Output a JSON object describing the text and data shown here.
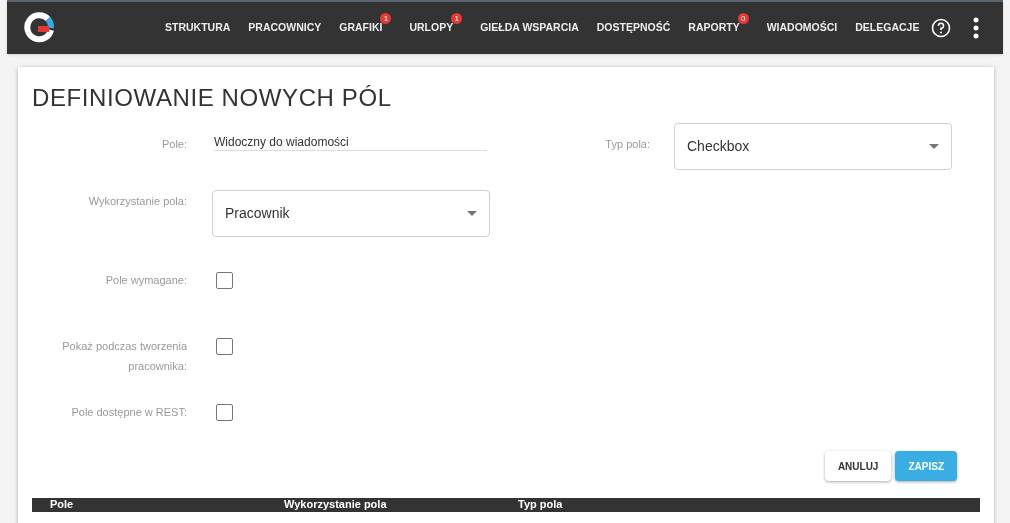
{
  "nav": {
    "items": [
      {
        "label": "STRUKTURA"
      },
      {
        "label": "PRACOWNICY"
      },
      {
        "label": "GRAFIKI",
        "badge": "1"
      },
      {
        "label": "URLOPY",
        "badge": "1"
      },
      {
        "label": "GIEŁDA WSPARCIA"
      },
      {
        "label": "DOSTĘPNOŚĆ"
      },
      {
        "label": "RAPORTY",
        "badge": "0"
      },
      {
        "label": "WIADOMOŚCI"
      },
      {
        "label": "DELEGACJE"
      }
    ]
  },
  "page": {
    "title": "DEFINIOWANIE NOWYCH PÓL"
  },
  "form": {
    "name_field": {
      "label": "Pole:",
      "value": "Widoczny do wiadomości"
    },
    "type_select": {
      "label": "Typ pola:",
      "value": "Checkbox"
    },
    "usage_select": {
      "label": "Wykorzystanie pola:",
      "value": "Pracownik"
    },
    "checkboxes": [
      {
        "label": "Pole wymagane:",
        "checked": false
      },
      {
        "label": "Pokaż podczas tworzenia pracownika:",
        "checked": false
      },
      {
        "label": "Pole dostępne w REST:",
        "checked": false
      }
    ]
  },
  "buttons": [
    {
      "label": "ANULUJ",
      "kind": "secondary"
    },
    {
      "label": "ZAPISZ",
      "kind": "primary"
    }
  ],
  "table": {
    "columns": [
      "Pole",
      "Wykorzystanie pola",
      "Typ pola"
    ]
  }
}
